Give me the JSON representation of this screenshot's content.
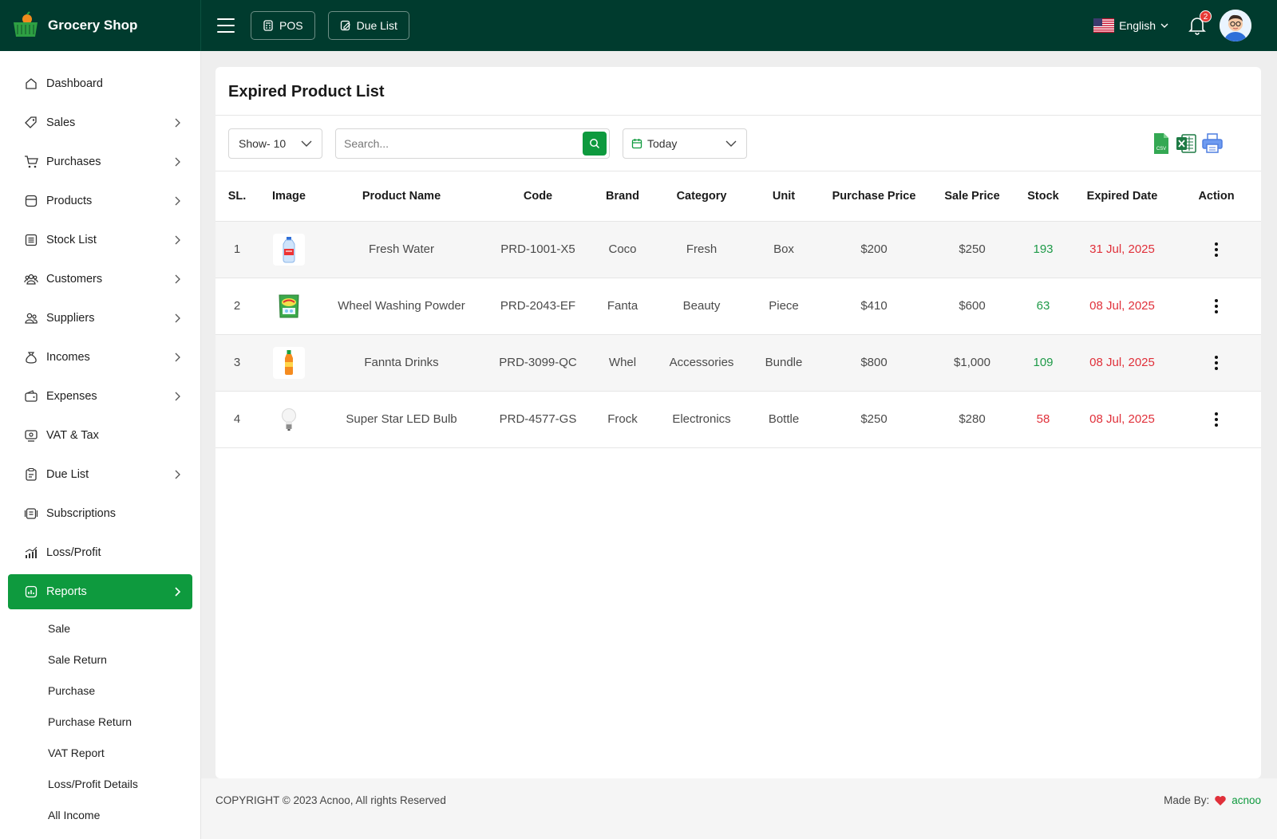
{
  "app": {
    "name": "Grocery Shop"
  },
  "header": {
    "pos_label": "POS",
    "due_list_label": "Due List",
    "language": "English",
    "notification_count": "2"
  },
  "sidebar": {
    "items": [
      {
        "label": "Dashboard",
        "icon": "home-icon"
      },
      {
        "label": "Sales",
        "icon": "tag-icon"
      },
      {
        "label": "Purchases",
        "icon": "cart-icon"
      },
      {
        "label": "Products",
        "icon": "box-icon"
      },
      {
        "label": "Stock List",
        "icon": "list-icon"
      },
      {
        "label": "Customers",
        "icon": "users-icon"
      },
      {
        "label": "Suppliers",
        "icon": "user-group-icon"
      },
      {
        "label": "Incomes",
        "icon": "money-bag-icon"
      },
      {
        "label": "Expenses",
        "icon": "wallet-icon"
      },
      {
        "label": "VAT & Tax",
        "icon": "receipt-icon"
      },
      {
        "label": "Due List",
        "icon": "clipboard-icon"
      },
      {
        "label": "Subscriptions",
        "icon": "subscription-icon"
      },
      {
        "label": "Loss/Profit",
        "icon": "chart-bar-icon"
      },
      {
        "label": "Reports",
        "icon": "report-icon"
      }
    ],
    "report_subitems": [
      "Sale",
      "Sale Return",
      "Purchase",
      "Purchase Return",
      "VAT Report",
      "Loss/Profit Details",
      "All Income"
    ]
  },
  "page": {
    "title": "Expired Product List",
    "show_select": "Show- 10",
    "search_placeholder": "Search...",
    "date_filter": "Today",
    "export": {
      "csv": "CSV"
    }
  },
  "table": {
    "headers": [
      "SL.",
      "Image",
      "Product Name",
      "Code",
      "Brand",
      "Category",
      "Unit",
      "Purchase Price",
      "Sale Price",
      "Stock",
      "Expired Date",
      "Action"
    ],
    "rows": [
      {
        "sl": "1",
        "image": "water-bottle-icon",
        "name": "Fresh Water",
        "code": "PRD-1001-X5",
        "brand": "Coco",
        "category": "Fresh",
        "unit": "Box",
        "purchase_price": "$200",
        "sale_price": "$250",
        "stock": "193",
        "expired": "31 Jul, 2025"
      },
      {
        "sl": "2",
        "image": "detergent-pack-icon",
        "name": "Wheel Washing Powder",
        "code": "PRD-2043-EF",
        "brand": "Fanta",
        "category": "Beauty",
        "unit": "Piece",
        "purchase_price": "$410",
        "sale_price": "$600",
        "stock": "63",
        "expired": "08 Jul, 2025"
      },
      {
        "sl": "3",
        "image": "drink-bottle-icon",
        "name": "Fannta Drinks",
        "code": "PRD-3099-QC",
        "brand": "Whel",
        "category": "Accessories",
        "unit": "Bundle",
        "purchase_price": "$800",
        "sale_price": "$1,000",
        "stock": "109",
        "expired": "08 Jul, 2025"
      },
      {
        "sl": "4",
        "image": "light-bulb-icon",
        "name": "Super Star LED Bulb",
        "code": "PRD-4577-GS",
        "brand": "Frock",
        "category": "Electronics",
        "unit": "Bottle",
        "purchase_price": "$250",
        "sale_price": "$280",
        "stock": "58",
        "expired": "08 Jul, 2025"
      }
    ]
  },
  "footer": {
    "copyright": "COPYRIGHT © 2023 Acnoo, All rights Reserved",
    "made_by": "Made By:",
    "author": "acnoo"
  },
  "colors": {
    "topbar": "#003b2e",
    "accent": "#0e9a3e",
    "danger": "#e0303a"
  }
}
